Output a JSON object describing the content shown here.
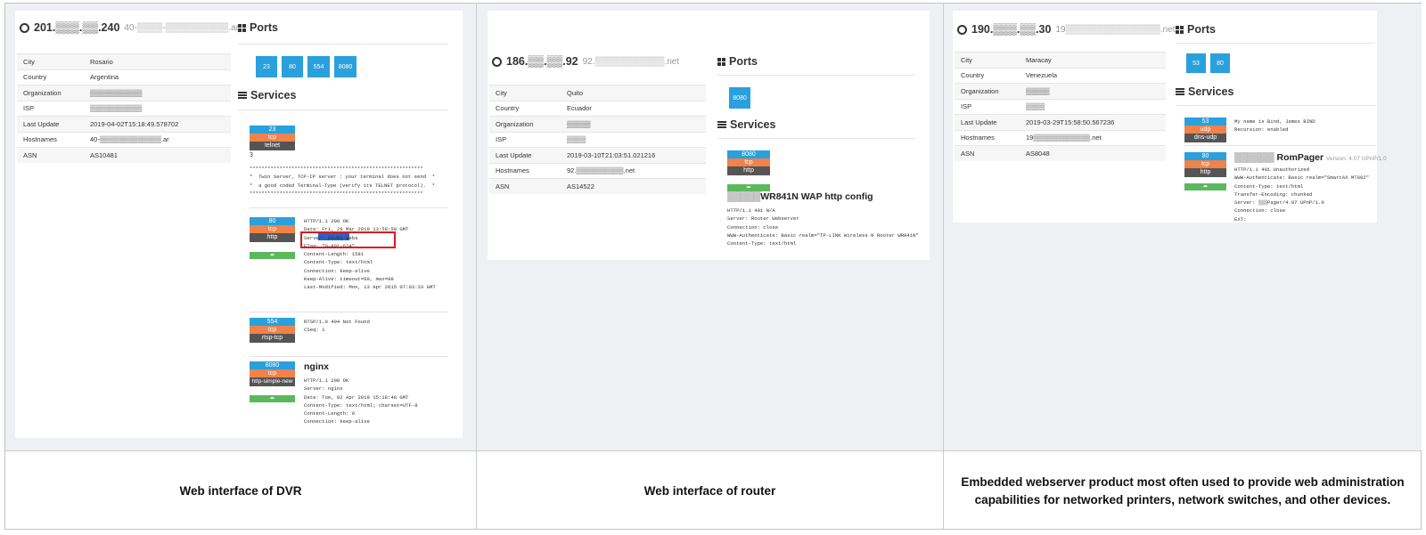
{
  "panels": [
    {
      "ip": "201.▒▒▒.▒▒.240",
      "hostname": "40-▒▒▒▒-▒▒▒▒▒▒▒▒▒▒.ar",
      "info": [
        {
          "label": "City",
          "value": "Rosario"
        },
        {
          "label": "Country",
          "value": "Argentina"
        },
        {
          "label": "Organization",
          "value": "▒▒▒▒▒▒▒▒▒▒▒"
        },
        {
          "label": "ISP",
          "value": "▒▒▒▒▒▒▒▒▒▒▒"
        },
        {
          "label": "Last Update",
          "value": "2019-04-02T15:18:49.578702"
        },
        {
          "label": "Hostnames",
          "value": "40-▒▒▒▒▒▒▒▒▒▒▒▒▒.ar"
        },
        {
          "label": "ASN",
          "value": "AS10481"
        }
      ],
      "ports_label": "Ports",
      "ports": [
        "23",
        "80",
        "554",
        "8080"
      ],
      "services_label": "Services",
      "services": [
        {
          "port": "23",
          "proto": "tcp",
          "name": "telnet",
          "extra": "3",
          "banner": "**********************************************************\n*  Twin Server, TCP-IP server : your terminal does not send  *\n*  a good coded Terminal-Type (verify its TELNET protocol).  *\n**********************************************************"
        },
        {
          "port": "80",
          "proto": "tcp",
          "name": "http",
          "banner": "HTTP/1.1 200 OK\nDate: Fri, 29 Mar 2019 13:58:58 GMT\nServer: DNVRS-Webs\nETag: \"0-801-624\"\nContent-Length: 1581\nContent-Type: text/html\nConnection: keep-alive\nKeep-Alive: timeout=60, max=99\nLast-Modified: Mon, 13 Apr 2015 07:03:33 GMT"
        },
        {
          "port": "554",
          "proto": "tcp",
          "name": "rtsp-tcp",
          "banner": "RTSP/1.0 404 Not Found\nCSeq: 1"
        },
        {
          "port": "8080",
          "proto": "tcp",
          "name": "http-simple-new",
          "title": "nginx",
          "banner": "HTTP/1.1 200 OK\nServer: nginx\nDate: Tue, 02 Apr 2019 15:18:48 GMT\nContent-Type: text/html; charset=UTF-8\nContent-Length: 0\nConnection: keep-alive"
        }
      ],
      "caption": "Web interface of DVR"
    },
    {
      "ip": "186.▒▒.▒▒.92",
      "hostname": "92.▒▒▒▒▒▒▒▒▒▒▒.net",
      "info": [
        {
          "label": "City",
          "value": "Quito"
        },
        {
          "label": "Country",
          "value": "Ecuador"
        },
        {
          "label": "Organization",
          "value": "▒▒▒▒▒"
        },
        {
          "label": "ISP",
          "value": "▒▒▒▒"
        },
        {
          "label": "Last Update",
          "value": "2019-03-10T21:03:51.021216"
        },
        {
          "label": "Hostnames",
          "value": "92.▒▒▒▒▒▒▒▒▒▒.net"
        },
        {
          "label": "ASN",
          "value": "AS14522"
        }
      ],
      "ports_label": "Ports",
      "ports": [
        "8080"
      ],
      "services_label": "Services",
      "services": [
        {
          "port": "8080",
          "proto": "tcp",
          "name": "http",
          "title": "▒▒▒▒▒WR841N WAP http config",
          "banner": "HTTP/1.1 401 N/A\nServer: Router Webserver\nConnection: close\nWWW-Authenticate: Basic realm=\"TP-LINK Wireless N Router WR841N\"\nContent-Type: text/html"
        }
      ],
      "caption": "Web interface of router"
    },
    {
      "ip": "190.▒▒▒.▒▒.30",
      "hostname": "19▒▒▒▒▒▒▒▒▒▒▒▒▒▒▒.net",
      "info": [
        {
          "label": "City",
          "value": "Maracay"
        },
        {
          "label": "Country",
          "value": "Venezuela"
        },
        {
          "label": "Organization",
          "value": "▒▒▒▒▒"
        },
        {
          "label": "ISP",
          "value": "▒▒▒▒"
        },
        {
          "label": "Last Update",
          "value": "2019-03-29T15:58:50.567236"
        },
        {
          "label": "Hostnames",
          "value": "19▒▒▒▒▒▒▒▒▒▒▒▒.net"
        },
        {
          "label": "ASN",
          "value": "AS8048"
        }
      ],
      "ports_label": "Ports",
      "ports": [
        "53",
        "80"
      ],
      "services_label": "Services",
      "services": [
        {
          "port": "53",
          "proto": "udp",
          "name": "dns-udp",
          "banner": "My name is Bind, James BIND\nRecursion: enabled"
        },
        {
          "port": "80",
          "proto": "tcp",
          "name": "http",
          "title": "▒▒▒▒▒▒ RomPager",
          "version": "Version: 4.07 UPnP/1.0",
          "banner": "HTTP/1.1 401 Unauthorized\nWWW-Authenticate: Basic realm=\"SmartAX MT882\"\nContent-Type: text/html\nTransfer-Encoding: chunked\nServer: ▒▒▒Pager/4.07 UPnP/1.0\nConnection: close\nEXT:"
        }
      ],
      "caption": "Embedded webserver product most often used to provide web administration capabilities for networked printers, network switches, and other devices."
    }
  ],
  "colors": {
    "port": "#2aa0dd",
    "proto": "#f0824b",
    "service": "#555555",
    "go": "#5cb85c",
    "highlight": "#e01818"
  },
  "icons": [
    "globe-icon",
    "ports-grid-icon",
    "services-list-icon",
    "share-arrow-icon"
  ]
}
